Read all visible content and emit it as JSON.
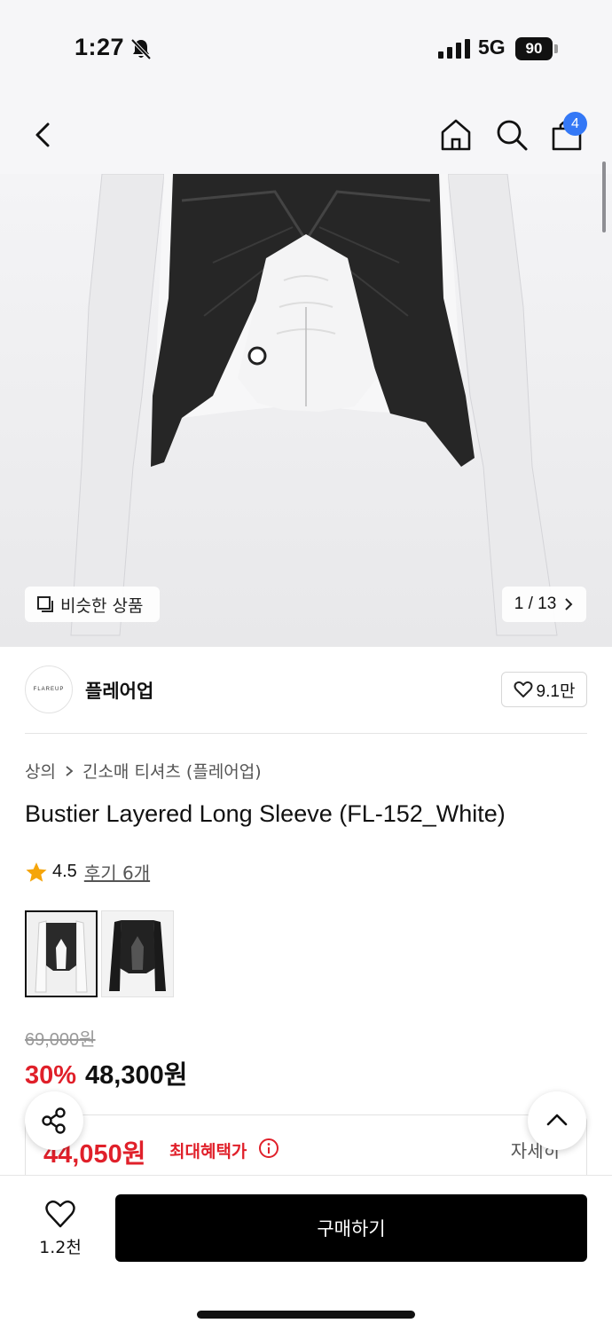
{
  "status_bar": {
    "time": "1:27",
    "network": "5G",
    "battery": "90"
  },
  "nav": {
    "cart_count": "4"
  },
  "gallery": {
    "similar_label": "비슷한 상품",
    "page_counter": "1 / 13"
  },
  "brand": {
    "logo_text": "FLAREUP",
    "name": "플레어업",
    "likes": "9.1만"
  },
  "breadcrumb": {
    "category": "상의",
    "subcategory": "긴소매 티셔츠 (플레어업)"
  },
  "product": {
    "title": "Bustier Layered Long Sleeve (FL-152_White)",
    "rating": "4.5",
    "reviews": "후기 6개",
    "original_price": "69,000원",
    "discount": "30%",
    "sale_price": "48,300원"
  },
  "benefit": {
    "price": "44,050원",
    "label": "최대혜택가",
    "details": "자세히"
  },
  "bottom_bar": {
    "wish_count": "1.2천",
    "buy_label": "구매하기"
  },
  "colors": {
    "accent_red": "#e0202a",
    "badge_blue": "#3478f6",
    "buy_button": "#000000"
  },
  "icons": [
    "bell-off-icon",
    "signal-icon",
    "back-icon",
    "home-icon",
    "search-icon",
    "cart-icon",
    "similar-icon",
    "chevron-right-icon",
    "heart-icon",
    "star-icon",
    "info-icon",
    "share-icon",
    "chevron-up-icon"
  ]
}
